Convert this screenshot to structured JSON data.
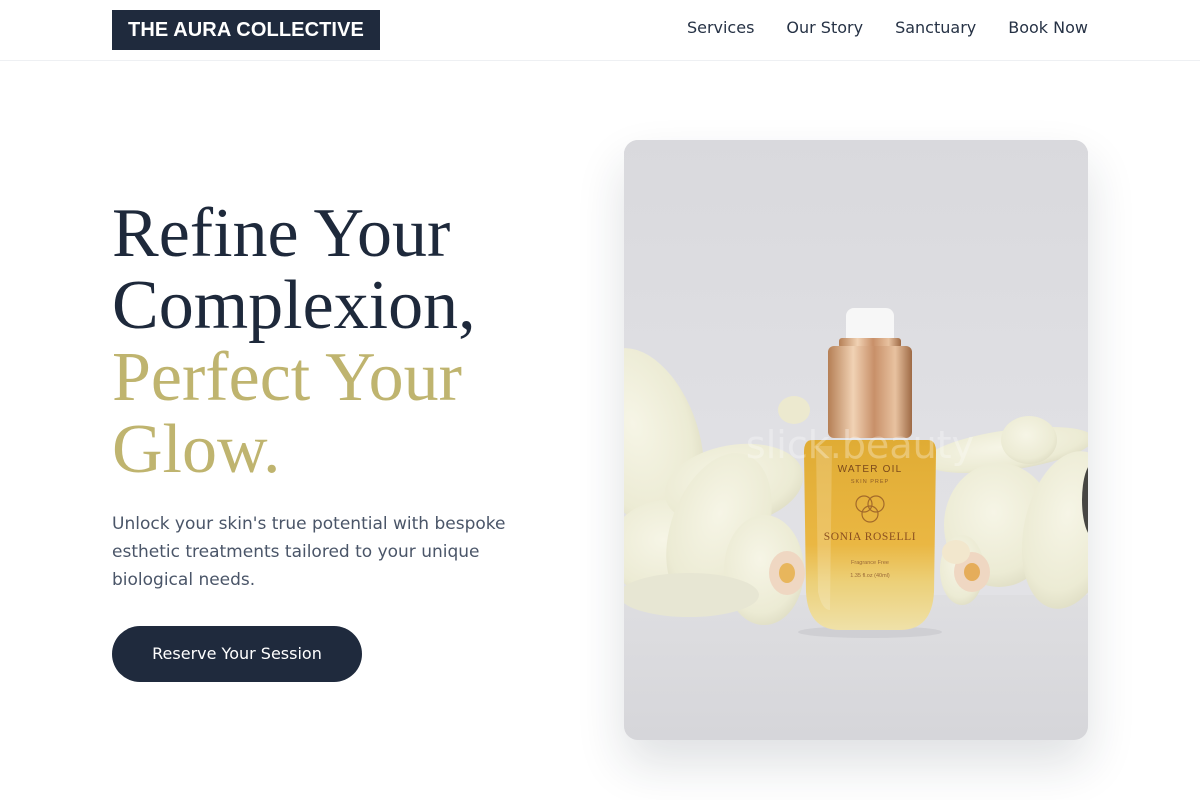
{
  "header": {
    "logo": "THE AURA COLLECTIVE",
    "nav": [
      "Services",
      "Our Story",
      "Sanctuary",
      "Book Now"
    ]
  },
  "hero": {
    "title_lines": [
      "Refine Your",
      "Complexion,"
    ],
    "title_accent_lines": [
      "Perfect Your",
      "Glow."
    ],
    "description": "Unlock your skin's true potential with bespoke esthetic treatments tailored to your unique biological needs.",
    "cta_label": "Reserve Your Session"
  },
  "image": {
    "alt": "Water oil serum bottle with white orchids",
    "watermark": "slick.beauty",
    "bottle_label": {
      "line1": "WATER OIL",
      "line2": "SKIN PREP",
      "brand": "SONIA ROSELLI",
      "line3": "Fragrance Free",
      "line4": "1.35 fl.oz (40ml)"
    }
  },
  "colors": {
    "navy": "#1f2a3d",
    "gold": "#bfb46f",
    "text_muted": "#4a5568"
  }
}
